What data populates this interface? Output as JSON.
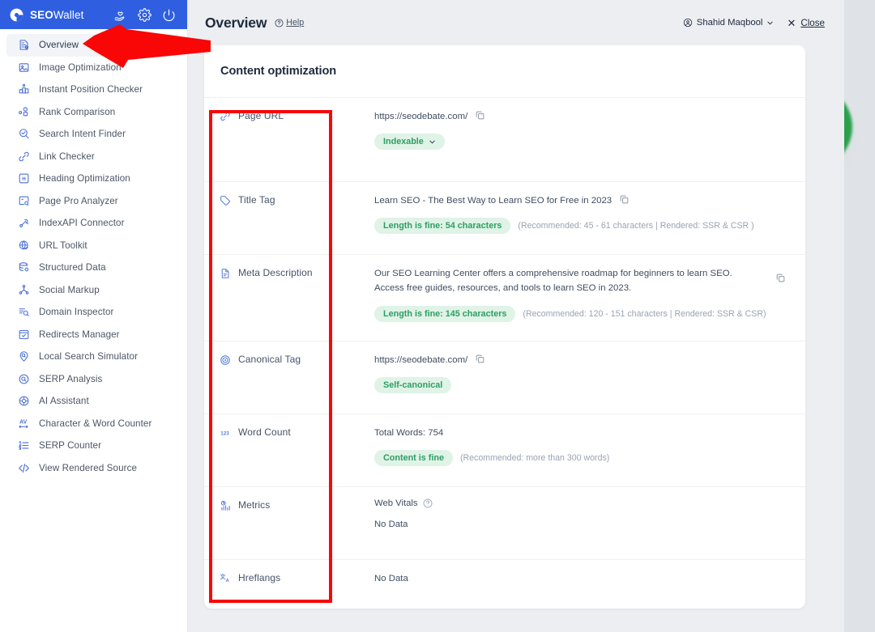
{
  "brand": {
    "name_bold": "SEO",
    "name_light": "Wallet",
    "icons": [
      "hand-heart-icon",
      "gear-icon",
      "power-icon"
    ]
  },
  "sidebar": {
    "items": [
      {
        "label": "Overview",
        "icon": "overview-icon",
        "active": true
      },
      {
        "label": "Image Optimization",
        "icon": "image-icon",
        "active": false
      },
      {
        "label": "Instant Position Checker",
        "icon": "podium-icon",
        "active": false
      },
      {
        "label": "Rank Comparison",
        "icon": "rank-compare-icon",
        "active": false
      },
      {
        "label": "Search Intent Finder",
        "icon": "search-check-icon",
        "active": false
      },
      {
        "label": "Link Checker",
        "icon": "link-icon",
        "active": false
      },
      {
        "label": "Heading Optimization",
        "icon": "heading-h-icon",
        "active": false
      },
      {
        "label": "Page Pro Analyzer",
        "icon": "page-analyze-icon",
        "active": false
      },
      {
        "label": "IndexAPI Connector",
        "icon": "api-connector-icon",
        "active": false
      },
      {
        "label": "URL Toolkit",
        "icon": "globe-check-icon",
        "active": false
      },
      {
        "label": "Structured Data",
        "icon": "database-gear-icon",
        "active": false
      },
      {
        "label": "Social Markup",
        "icon": "share-nodes-icon",
        "active": false
      },
      {
        "label": "Domain Inspector",
        "icon": "domain-search-icon",
        "active": false
      },
      {
        "label": "Redirects Manager",
        "icon": "window-check-icon",
        "active": false
      },
      {
        "label": "Local Search Simulator",
        "icon": "map-pin-search-icon",
        "active": false
      },
      {
        "label": "SERP Analysis",
        "icon": "serp-circle-icon",
        "active": false
      },
      {
        "label": "AI Assistant",
        "icon": "ai-chat-icon",
        "active": false
      },
      {
        "label": "Character & Word Counter",
        "icon": "av-counter-icon",
        "active": false
      },
      {
        "label": "SERP Counter",
        "icon": "list-counter-icon",
        "active": false
      },
      {
        "label": "View Rendered Source",
        "icon": "code-brackets-icon",
        "active": false
      }
    ]
  },
  "header": {
    "title": "Overview",
    "help_label": "Help",
    "user_name": "Shahid Maqbool",
    "close_label": "Close"
  },
  "card": {
    "title": "Content optimization",
    "rows": [
      {
        "label": "Page URL",
        "icon": "link-diagonal-icon",
        "value": "https://seodebate.com/",
        "badge": "Indexable",
        "badge_has_chevron": true,
        "recommendation": ""
      },
      {
        "label": "Title Tag",
        "icon": "tag-icon",
        "value": "Learn SEO - The Best Way to Learn SEO for Free in 2023",
        "badge": "Length is fine: 54 characters",
        "badge_has_chevron": false,
        "recommendation": "(Recommended: 45 - 61 characters | Rendered: SSR & CSR )"
      },
      {
        "label": "Meta Description",
        "icon": "document-icon",
        "value": "Our SEO Learning Center offers a comprehensive roadmap for beginners to learn SEO. Access free guides, resources, and tools to learn SEO in 2023.",
        "badge": "Length is fine: 145 characters",
        "badge_has_chevron": false,
        "recommendation": "(Recommended: 120 - 151 characters | Rendered: SSR & CSR)"
      },
      {
        "label": "Canonical Tag",
        "icon": "target-icon",
        "value": "https://seodebate.com/",
        "badge": "Self-canonical",
        "badge_has_chevron": false,
        "recommendation": ""
      },
      {
        "label": "Word Count",
        "icon": "123-icon",
        "value": "Total Words: 754",
        "badge": "Content is fine",
        "badge_has_chevron": false,
        "recommendation": "(Recommended: more than 300 words)"
      },
      {
        "label": "Metrics",
        "icon": "metrics-chart-icon",
        "subhead": "Web Vitals",
        "value": "No Data",
        "badge": "",
        "recommendation": ""
      },
      {
        "label": "Hreflangs",
        "icon": "translate-icon",
        "value": "No Data",
        "badge": "",
        "recommendation": ""
      }
    ]
  },
  "annotations": {
    "red_box": "highlight-box-around-row-labels",
    "red_arrow": "arrow-pointing-to-overview-nav-item"
  },
  "colors": {
    "brand_blue": "#2f5fe0",
    "accent_icon_blue": "#5b7ddd",
    "badge_bg": "#dff3e7",
    "badge_text": "#2f9e63",
    "annotation_red": "#f90606",
    "gauge_green": "#1f9d45"
  }
}
